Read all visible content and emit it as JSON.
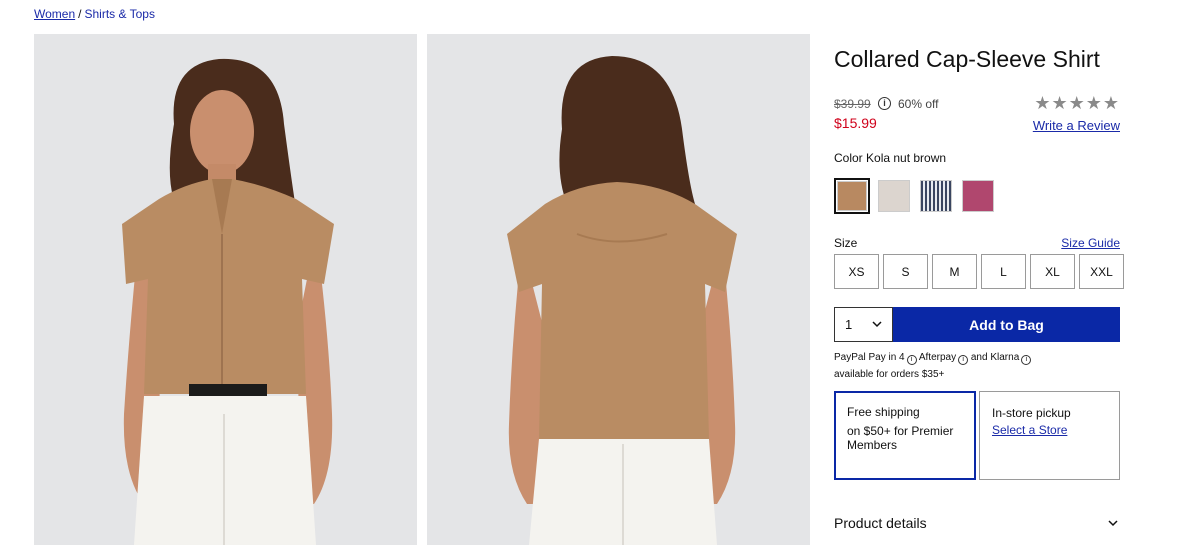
{
  "breadcrumb": {
    "items": [
      "Women",
      "Shirts & Tops"
    ],
    "separator": "/"
  },
  "product": {
    "title": "Collared Cap-Sleeve Shirt",
    "original_price": "$39.99",
    "discount": "60% off",
    "sale_price": "$15.99",
    "rating_stars": "★★★★★",
    "rating": 0,
    "write_review": "Write a Review"
  },
  "color": {
    "label": "Color Kola nut brown",
    "swatches": [
      {
        "name": "Kola nut brown",
        "hex": "#b88961",
        "selected": true
      },
      {
        "name": "light taupe",
        "hex": "#dcd5cf",
        "selected": false
      },
      {
        "name": "blue stripe",
        "hex": "#6f7890",
        "selected": false
      },
      {
        "name": "berry",
        "hex": "#b0476e",
        "selected": false
      }
    ]
  },
  "size": {
    "label": "Size",
    "guide": "Size Guide",
    "options": [
      "XS",
      "S",
      "M",
      "L",
      "XL",
      "XXL"
    ]
  },
  "cart": {
    "quantity": "1",
    "add_label": "Add to Bag"
  },
  "paylater": {
    "line1_prefix": "PayPal Pay in 4",
    "afterpay": "Afterpay",
    "and": "and",
    "klarna": "Klarna",
    "line2": "available for orders $35+"
  },
  "shipping": {
    "line1": "Free shipping",
    "line2": "on $50+ for Premier Members"
  },
  "pickup": {
    "title": "In-store pickup",
    "link": "Select a Store"
  },
  "details": {
    "label": "Product details"
  },
  "colors": {
    "accent": "#0a28a6",
    "link": "#1a2aa8",
    "sale": "#d0021b"
  }
}
